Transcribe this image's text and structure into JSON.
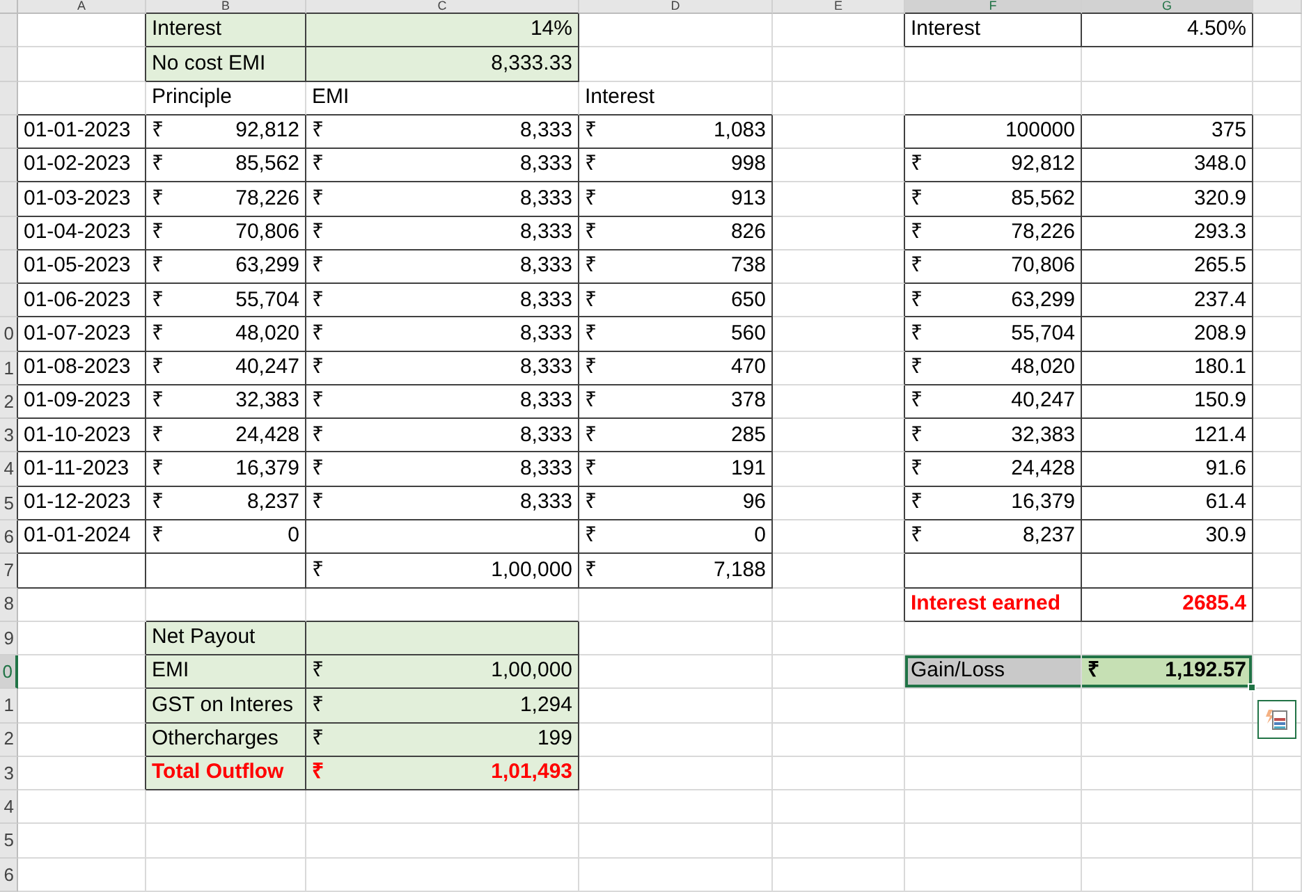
{
  "column_headers": [
    "A",
    "B",
    "C",
    "D",
    "E",
    "F",
    "G"
  ],
  "row_headers": [
    "0",
    "1",
    "2",
    "3",
    "4",
    "5",
    "6",
    "7",
    "8",
    "9",
    "0",
    "1",
    "2",
    "3",
    "4",
    "5",
    "6"
  ],
  "loan": {
    "interest_label": "Interest",
    "interest_value": "14%",
    "emi_label": "No cost EMI",
    "emi_value": "8,333.33"
  },
  "schedule": {
    "columns": [
      "Principle",
      "EMI",
      "Interest"
    ],
    "rows": [
      {
        "date": "01-01-2023",
        "principal": {
          "currency": "₹",
          "amount": "92,812"
        },
        "emi": {
          "currency": "₹",
          "amount": "8,333"
        },
        "interest": {
          "currency": "₹",
          "amount": "1,083"
        }
      },
      {
        "date": "01-02-2023",
        "principal": {
          "currency": "₹",
          "amount": "85,562"
        },
        "emi": {
          "currency": "₹",
          "amount": "8,333"
        },
        "interest": {
          "currency": "₹",
          "amount": "998"
        }
      },
      {
        "date": "01-03-2023",
        "principal": {
          "currency": "₹",
          "amount": "78,226"
        },
        "emi": {
          "currency": "₹",
          "amount": "8,333"
        },
        "interest": {
          "currency": "₹",
          "amount": "913"
        }
      },
      {
        "date": "01-04-2023",
        "principal": {
          "currency": "₹",
          "amount": "70,806"
        },
        "emi": {
          "currency": "₹",
          "amount": "8,333"
        },
        "interest": {
          "currency": "₹",
          "amount": "826"
        }
      },
      {
        "date": "01-05-2023",
        "principal": {
          "currency": "₹",
          "amount": "63,299"
        },
        "emi": {
          "currency": "₹",
          "amount": "8,333"
        },
        "interest": {
          "currency": "₹",
          "amount": "738"
        }
      },
      {
        "date": "01-06-2023",
        "principal": {
          "currency": "₹",
          "amount": "55,704"
        },
        "emi": {
          "currency": "₹",
          "amount": "8,333"
        },
        "interest": {
          "currency": "₹",
          "amount": "650"
        }
      },
      {
        "date": "01-07-2023",
        "principal": {
          "currency": "₹",
          "amount": "48,020"
        },
        "emi": {
          "currency": "₹",
          "amount": "8,333"
        },
        "interest": {
          "currency": "₹",
          "amount": "560"
        }
      },
      {
        "date": "01-08-2023",
        "principal": {
          "currency": "₹",
          "amount": "40,247"
        },
        "emi": {
          "currency": "₹",
          "amount": "8,333"
        },
        "interest": {
          "currency": "₹",
          "amount": "470"
        }
      },
      {
        "date": "01-09-2023",
        "principal": {
          "currency": "₹",
          "amount": "32,383"
        },
        "emi": {
          "currency": "₹",
          "amount": "8,333"
        },
        "interest": {
          "currency": "₹",
          "amount": "378"
        }
      },
      {
        "date": "01-10-2023",
        "principal": {
          "currency": "₹",
          "amount": "24,428"
        },
        "emi": {
          "currency": "₹",
          "amount": "8,333"
        },
        "interest": {
          "currency": "₹",
          "amount": "285"
        }
      },
      {
        "date": "01-11-2023",
        "principal": {
          "currency": "₹",
          "amount": "16,379"
        },
        "emi": {
          "currency": "₹",
          "amount": "8,333"
        },
        "interest": {
          "currency": "₹",
          "amount": "191"
        }
      },
      {
        "date": "01-12-2023",
        "principal": {
          "currency": "₹",
          "amount": "8,237"
        },
        "emi": {
          "currency": "₹",
          "amount": "8,333"
        },
        "interest": {
          "currency": "₹",
          "amount": "96"
        }
      },
      {
        "date": "01-01-2024",
        "principal": {
          "currency": "₹",
          "amount": "0"
        },
        "interest": {
          "currency": "₹",
          "amount": "0"
        }
      }
    ],
    "total": {
      "emi": {
        "currency": "₹",
        "amount": "1,00,000"
      },
      "interest": {
        "currency": "₹",
        "amount": "7,188"
      }
    }
  },
  "deposit": {
    "interest_label": "Interest",
    "interest_value": "4.50%",
    "rows": [
      {
        "balance": {
          "amount": "100000"
        },
        "interest": "375"
      },
      {
        "balance": {
          "currency": "₹",
          "amount": "92,812"
        },
        "interest": "348.0"
      },
      {
        "balance": {
          "currency": "₹",
          "amount": "85,562"
        },
        "interest": "320.9"
      },
      {
        "balance": {
          "currency": "₹",
          "amount": "78,226"
        },
        "interest": "293.3"
      },
      {
        "balance": {
          "currency": "₹",
          "amount": "70,806"
        },
        "interest": "265.5"
      },
      {
        "balance": {
          "currency": "₹",
          "amount": "63,299"
        },
        "interest": "237.4"
      },
      {
        "balance": {
          "currency": "₹",
          "amount": "55,704"
        },
        "interest": "208.9"
      },
      {
        "balance": {
          "currency": "₹",
          "amount": "48,020"
        },
        "interest": "180.1"
      },
      {
        "balance": {
          "currency": "₹",
          "amount": "40,247"
        },
        "interest": "150.9"
      },
      {
        "balance": {
          "currency": "₹",
          "amount": "32,383"
        },
        "interest": "121.4"
      },
      {
        "balance": {
          "currency": "₹",
          "amount": "24,428"
        },
        "interest": "91.6"
      },
      {
        "balance": {
          "currency": "₹",
          "amount": "16,379"
        },
        "interest": "61.4"
      },
      {
        "balance": {
          "currency": "₹",
          "amount": "8,237"
        },
        "interest": "30.9"
      }
    ],
    "earned_label": "Interest earned",
    "earned_value": "2685.4"
  },
  "gain_loss": {
    "label": "Gain/Loss",
    "currency": "₹",
    "amount": "1,192.57",
    "selected": true
  },
  "net_payout": {
    "title": "Net Payout",
    "rows": [
      {
        "kind": "item",
        "label": "EMI",
        "currency": "₹",
        "amount": "1,00,000"
      },
      {
        "kind": "item",
        "label": "GST on Interes",
        "currency": "₹",
        "amount": "1,294"
      },
      {
        "kind": "item",
        "label": "Othercharges",
        "currency": "₹",
        "amount": "199"
      },
      {
        "kind": "total",
        "label": "Total Outflow",
        "currency": "₹",
        "amount": "1,01,493"
      }
    ]
  }
}
